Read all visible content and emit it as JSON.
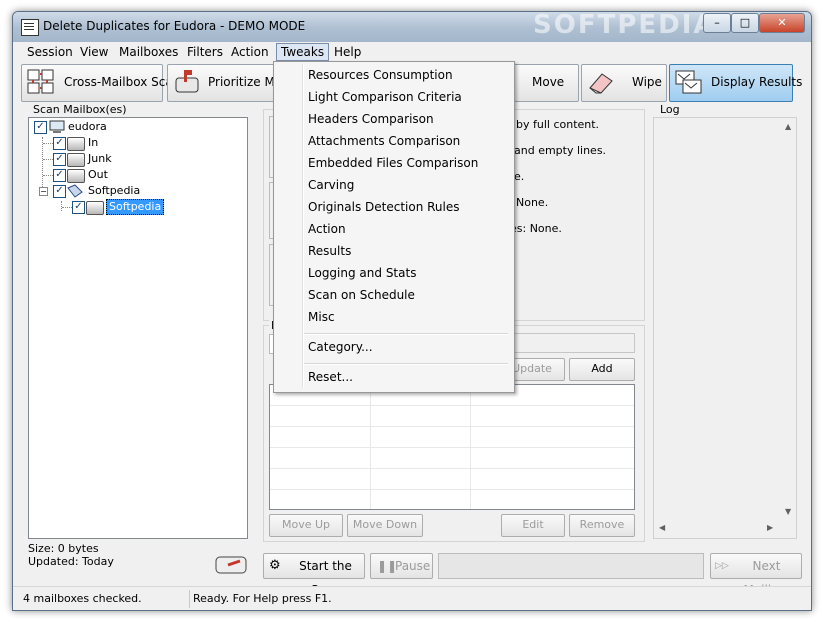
{
  "window": {
    "title": "Delete Duplicates for Eudora - DEMO MODE",
    "watermark": "SOFTPEDIA",
    "minimize": "–",
    "maximize": "□",
    "close": "✕"
  },
  "menu": [
    "Session",
    "View",
    "Mailboxes",
    "Filters",
    "Action",
    "Tweaks",
    "Help"
  ],
  "toolbar": {
    "cross_mailbox_scan": "Cross-Mailbox Scan",
    "prioritize_mail": "Prioritize Mail",
    "move": "Move",
    "wipe": "Wipe",
    "display_results": "Display Results"
  },
  "scan_panel": {
    "label": "Scan Mailbox(es)",
    "tree": [
      {
        "label": "eudora",
        "checked": true
      },
      {
        "label": "In",
        "checked": true
      },
      {
        "label": "Junk",
        "checked": true
      },
      {
        "label": "Out",
        "checked": true
      },
      {
        "label": "Softpedia",
        "checked": true
      },
      {
        "label": "Softpedia",
        "checked": true,
        "selected": true
      }
    ],
    "size": "Size: 0 bytes",
    "updated": "Updated: Today"
  },
  "criteria_lines": [
    "by full content.",
    "and empty lines.",
    "e.",
    "None.",
    "es: None."
  ],
  "filter_panel": {
    "label_fragment": "F",
    "update": "Update",
    "add": "Add",
    "move_up": "Move Up",
    "move_down": "Move Down",
    "edit": "Edit",
    "remove": "Remove"
  },
  "log_label": "Log",
  "bottom": {
    "start_scan": "Start the Scan",
    "pause": "Pause",
    "next_mailbox": "Next Mailbox"
  },
  "tweaks_menu": {
    "items": [
      "Resources Consumption",
      "Light Comparison Criteria",
      "Headers Comparison",
      "Attachments Comparison",
      "Embedded Files Comparison",
      "Carving",
      "Originals Detection Rules",
      "Action",
      "Results",
      "Logging and Stats",
      "Scan on Schedule",
      "Misc"
    ],
    "category": "Category...",
    "reset": "Reset..."
  },
  "status": {
    "checked": "4 mailboxes checked.",
    "ready": "Ready. For Help press F1."
  },
  "colors": {
    "accent": "#9fcdf0",
    "selection": "#3399ff",
    "mailbox_flag": "#c0392b"
  }
}
